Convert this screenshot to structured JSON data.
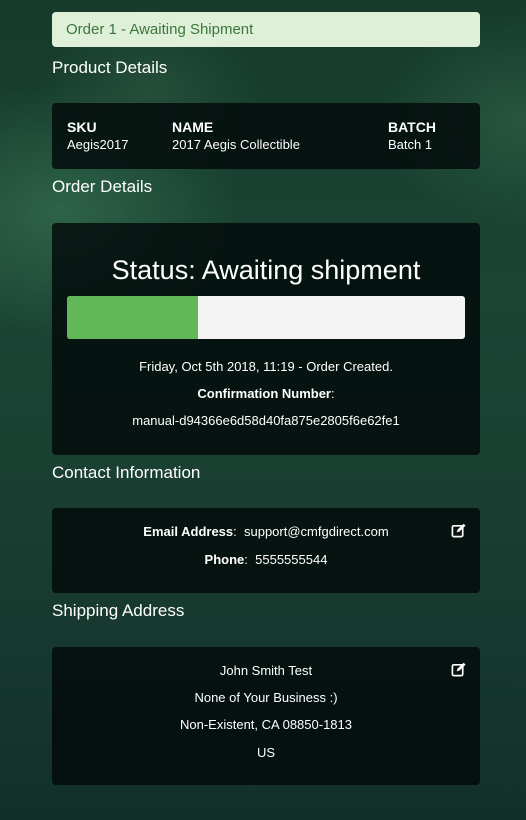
{
  "alert": {
    "text": "Order 1 - Awaiting Shipment"
  },
  "product": {
    "section_title": "Product Details",
    "headers": {
      "sku": "SKU",
      "name": "NAME",
      "batch": "BATCH"
    },
    "row": {
      "sku": "Aegis2017",
      "name": "2017 Aegis Collectible",
      "batch": "Batch 1"
    }
  },
  "order": {
    "section_title": "Order Details",
    "status_title": "Status: Awaiting shipment",
    "progress_fraction": 0.33,
    "progress_color": "#62b758",
    "created_line": "Friday, Oct 5th 2018, 11:19 - Order Created.",
    "confirmation_label": "Confirmation Number",
    "confirmation_number": "manual-d94366e6d58d40fa875e2805f6e62fe1"
  },
  "contact": {
    "section_title": "Contact Information",
    "email_label": "Email Address",
    "email_value": "support@cmfgdirect.com",
    "phone_label": "Phone",
    "phone_value": "5555555544",
    "edit_icon": "edit-icon"
  },
  "shipping": {
    "section_title": "Shipping Address",
    "name": "John Smith Test",
    "line1": "None of Your Business :)",
    "city_line": "Non-Existent, CA 08850-1813",
    "country": "US",
    "edit_icon": "edit-icon"
  }
}
